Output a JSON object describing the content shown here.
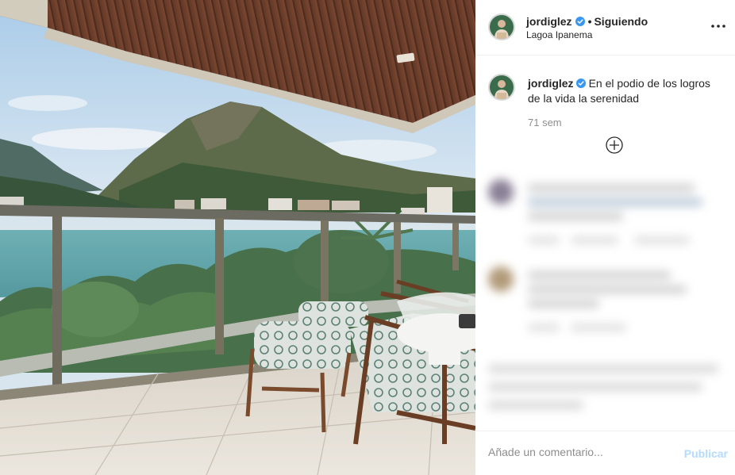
{
  "post": {
    "username": "jordiglez",
    "separator": "•",
    "follow_status": "Siguiendo",
    "location": "Lagoa Ipanema",
    "caption_text": "En el podio de los logros de la vida la serenidad",
    "time_ago": "71 sem",
    "comment_placeholder": "Añade un comentario...",
    "publish_label": "Publicar"
  },
  "colors": {
    "verified": "#3897f0",
    "publish_disabled": "#b3dbff",
    "muted_text": "#8e8e8e",
    "border": "#efefef"
  },
  "icons": {
    "verified": "verified-badge-icon",
    "more": "more-options-icon",
    "load_more": "load-more-comments-icon"
  }
}
